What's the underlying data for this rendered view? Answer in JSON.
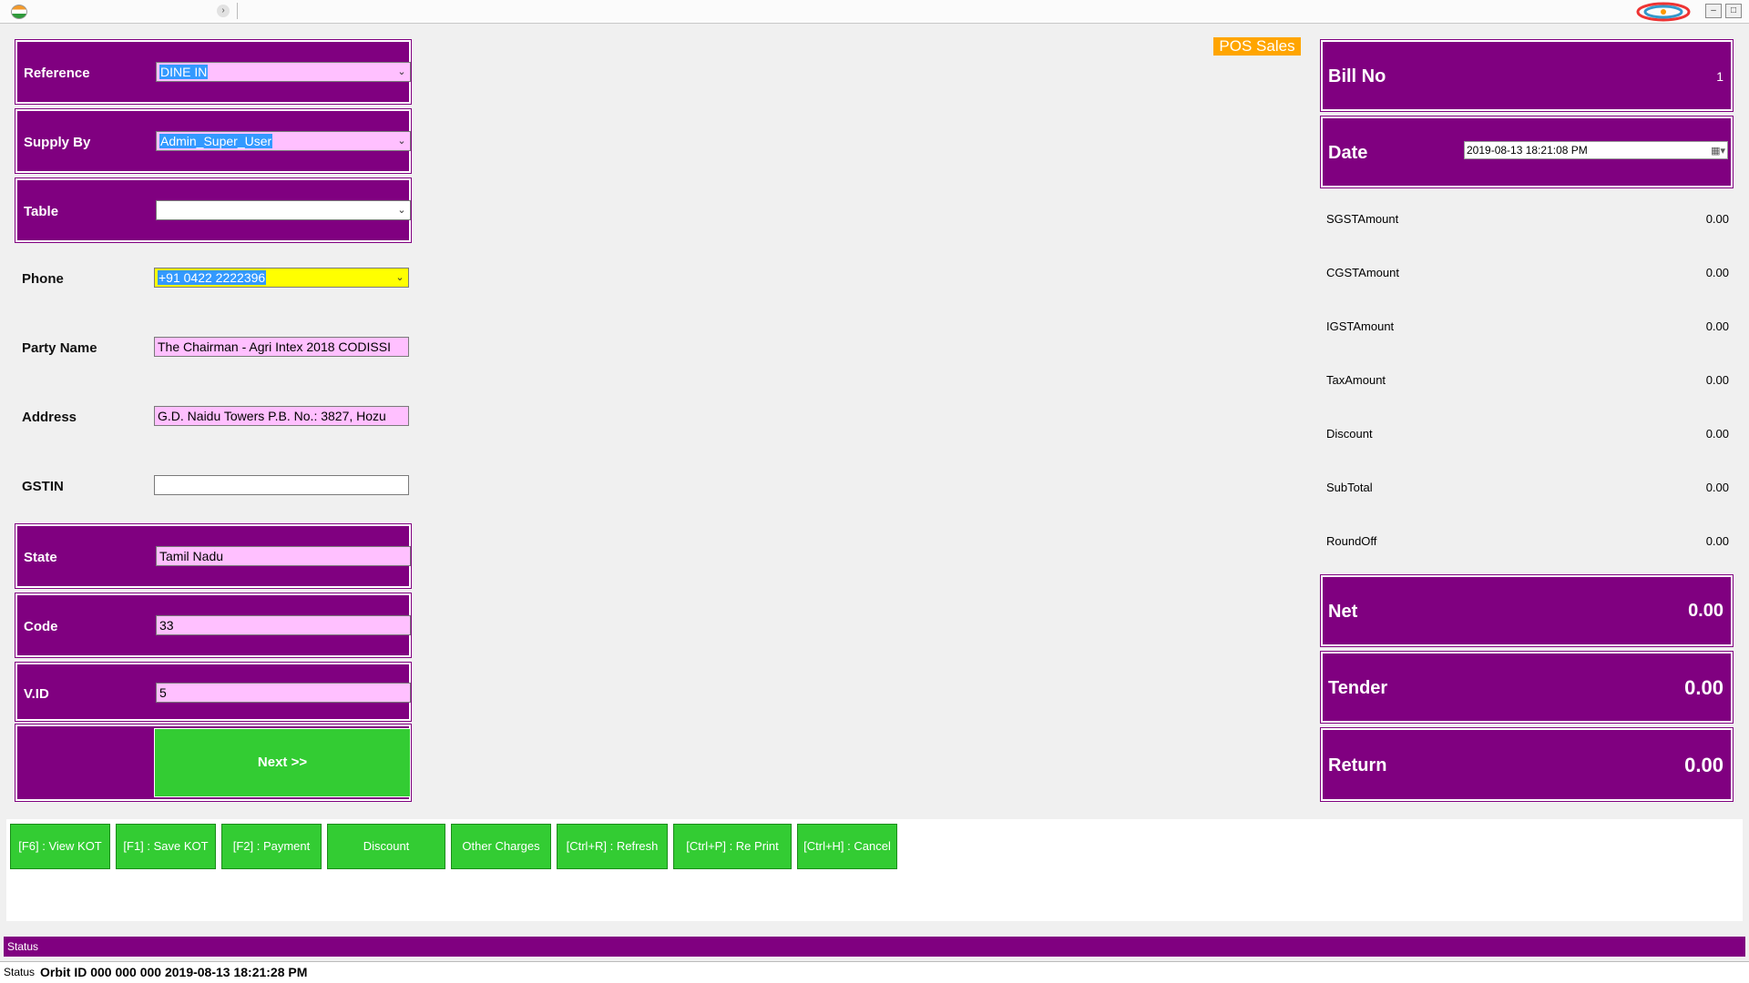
{
  "titlebar": {
    "minimize": "–",
    "maximize": "□",
    "tab_arrow": "›",
    "colors": {
      "brand": "#800080",
      "accent_green": "#33cc33",
      "highlight_pink": "#ffc0ff",
      "orange": "#ffa500"
    }
  },
  "badge": "POS Sales",
  "form": {
    "reference": {
      "label": "Reference",
      "value": "DINE IN"
    },
    "supply_by": {
      "label": "Supply By",
      "value": "Admin_Super_User"
    },
    "table": {
      "label": "Table",
      "value": ""
    },
    "phone": {
      "label": "Phone",
      "value": "+91 0422 2222396"
    },
    "party_name": {
      "label": "Party Name",
      "value": "The Chairman - Agri Intex 2018 CODISSI"
    },
    "address": {
      "label": "Address",
      "value": "G.D. Naidu Towers P.B. No.: 3827, Hozu"
    },
    "gstin": {
      "label": "GSTIN",
      "value": ""
    },
    "state": {
      "label": "State",
      "value": "Tamil Nadu"
    },
    "code": {
      "label": "Code",
      "value": "33"
    },
    "vid": {
      "label": "V.ID",
      "value": "5"
    },
    "next": "Next >>"
  },
  "summary": {
    "bill_no": {
      "label": "Bill No",
      "value": "1"
    },
    "date": {
      "label": "Date",
      "value": "2019-08-13 18:21:08 PM"
    },
    "rows": [
      {
        "label": "SGSTAmount",
        "value": "0.00"
      },
      {
        "label": "CGSTAmount",
        "value": "0.00"
      },
      {
        "label": "IGSTAmount",
        "value": "0.00"
      },
      {
        "label": "TaxAmount",
        "value": "0.00"
      },
      {
        "label": "Discount",
        "value": "0.00"
      },
      {
        "label": "SubTotal",
        "value": "0.00"
      },
      {
        "label": "RoundOff",
        "value": "0.00"
      }
    ],
    "net": {
      "label": "Net",
      "value": "0.00"
    },
    "tender": {
      "label": "Tender",
      "value": "0.00"
    },
    "return": {
      "label": "Return",
      "value": "0.00"
    }
  },
  "buttons": [
    "[F6] : View KOT",
    "[F1] : Save KOT",
    "[F2] : Payment",
    "Discount",
    "Other Charges",
    "[Ctrl+R] : Refresh",
    "[Ctrl+P] : Re Print",
    "[Ctrl+H] : Cancel"
  ],
  "status": {
    "bar_label": "Status",
    "bottom_label": "Status",
    "bottom_text": "Orbit ID  000 000 000  2019-08-13 18:21:28 PM"
  }
}
